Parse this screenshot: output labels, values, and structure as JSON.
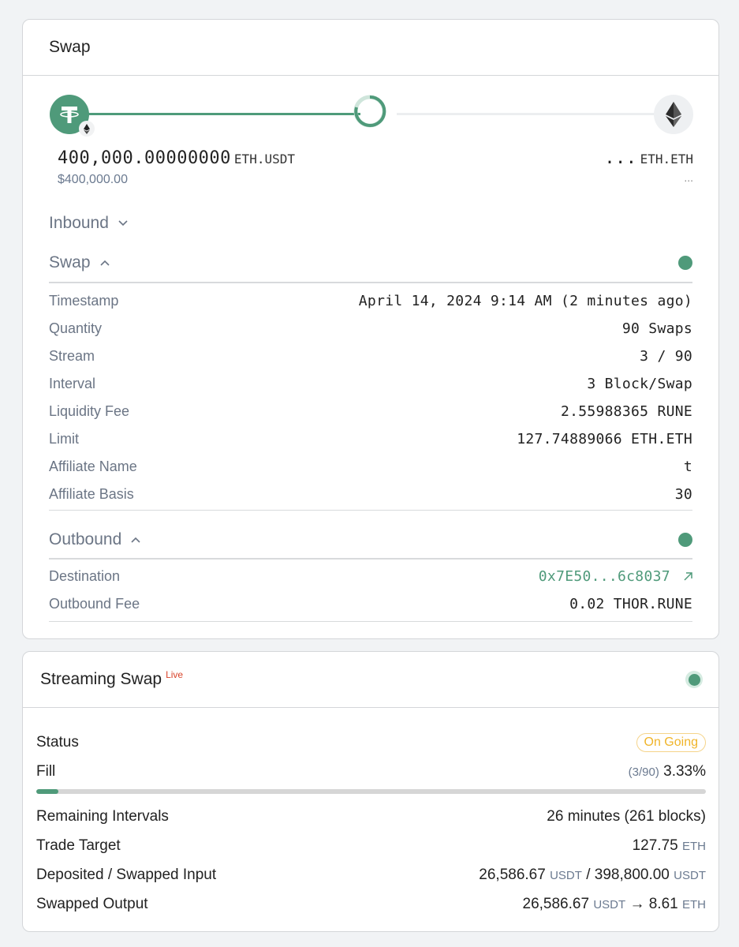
{
  "swap_card": {
    "title": "Swap",
    "route": {
      "from_icon": "tether-usdt-icon",
      "from_chain_icon": "ethereum-icon",
      "to_icon": "ethereum-icon",
      "progress_state": "in-progress"
    },
    "from": {
      "amount": "400,000.00000000",
      "asset": "ETH.USDT",
      "usd": "$400,000.00"
    },
    "to": {
      "amount": "...",
      "asset": "ETH.ETH",
      "usd": "..."
    },
    "inbound": {
      "title": "Inbound",
      "expanded": false
    },
    "swap_section": {
      "title": "Swap",
      "expanded": true,
      "rows": [
        {
          "label": "Timestamp",
          "value": "April 14, 2024 9:14 AM (2 minutes ago)"
        },
        {
          "label": "Quantity",
          "value": "90 Swaps"
        },
        {
          "label": "Stream",
          "value": "3 / 90"
        },
        {
          "label": "Interval",
          "value": "3 Block/Swap"
        },
        {
          "label": "Liquidity Fee",
          "value": "2.55988365 RUNE"
        },
        {
          "label": "Limit",
          "value": "127.74889066 ETH.ETH"
        },
        {
          "label": "Affiliate Name",
          "value": "t"
        },
        {
          "label": "Affiliate Basis",
          "value": "30"
        }
      ]
    },
    "outbound_section": {
      "title": "Outbound",
      "expanded": true,
      "rows": [
        {
          "label": "Destination",
          "value": "0x7E50...6c8037",
          "link": true
        },
        {
          "label": "Outbound Fee",
          "value": "0.02 THOR.RUNE"
        }
      ]
    },
    "colors": {
      "accent": "#4f9a7a"
    }
  },
  "streaming_card": {
    "title": "Streaming Swap",
    "live_label": "Live",
    "status_label": "Status",
    "status_value": "On Going",
    "fill_label": "Fill",
    "fill_count": "(3/90)",
    "fill_percent": "3.33%",
    "fill_fraction": 0.0333,
    "remaining_label": "Remaining Intervals",
    "remaining_value": "26 minutes (261 blocks)",
    "trade_target_label": "Trade Target",
    "trade_target_amount": "127.75",
    "trade_target_unit": "ETH",
    "deposited_label": "Deposited / Swapped Input",
    "deposited_amount": "26,586.67",
    "deposited_unit": "USDT",
    "deposited_sep": "/",
    "swapped_input_amount": "398,800.00",
    "swapped_input_unit": "USDT",
    "output_label": "Swapped Output",
    "output_in_amount": "26,586.67",
    "output_in_unit": "USDT",
    "output_arrow": "→",
    "output_out_amount": "8.61",
    "output_out_unit": "ETH",
    "colors": {
      "live": "#d9442b",
      "ongoing": "#f0b429"
    }
  }
}
